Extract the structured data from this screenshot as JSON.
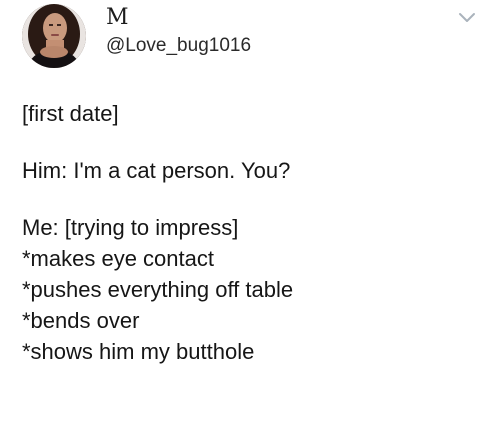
{
  "tweet": {
    "display_name": "M",
    "handle": "@Love_bug1016",
    "avatar_icon": "user-avatar-photo",
    "menu_icon": "chevron-down-icon",
    "lines": [
      "[first date]",
      "Him: I'm a cat person. You?",
      "Me: [trying to impress]",
      "*makes eye contact",
      "*pushes everything off table",
      "*bends over",
      "*shows him my butthole"
    ]
  }
}
